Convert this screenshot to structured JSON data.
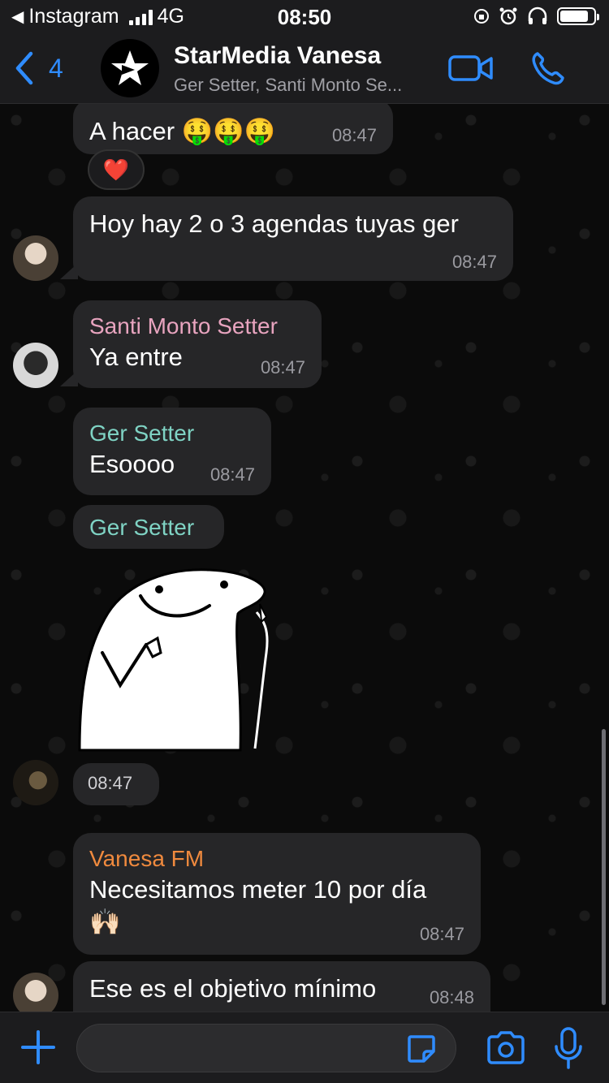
{
  "status_bar": {
    "back_app": "Instagram",
    "network": "4G",
    "time": "08:50",
    "battery_level": 0.85
  },
  "header": {
    "back_count": "4",
    "title": "StarMedia Vanesa",
    "subtitle": "Ger Setter, Santi Monto Se..."
  },
  "messages": [
    {
      "text": "A hacer 🤑🤑🤑",
      "time": "08:47",
      "reaction": "❤️"
    },
    {
      "text": "Hoy hay 2 o 3 agendas tuyas ger",
      "time": "08:47"
    },
    {
      "sender": "Santi Monto Setter",
      "text": "Ya entre",
      "time": "08:47"
    },
    {
      "sender": "Ger Setter",
      "text": "Esoooo",
      "time": "08:47"
    },
    {
      "sender": "Ger Setter",
      "sticker": "thumbs-up-blob-sticker",
      "time": "08:47"
    },
    {
      "sender": "Vanesa FM",
      "text": "Necesitamos meter 10 por día",
      "emoji": "🙌🏻",
      "time": "08:47"
    },
    {
      "text": "Ese es el objetivo mínimo",
      "time": "08:48"
    }
  ],
  "colors": {
    "accent": "#2f8cff",
    "santi": "#e8a4bf",
    "ger": "#7fd3c4",
    "vanesa": "#f08a3e",
    "bubble": "#262628",
    "background": "#0b0b0b"
  },
  "input": {
    "placeholder": ""
  }
}
